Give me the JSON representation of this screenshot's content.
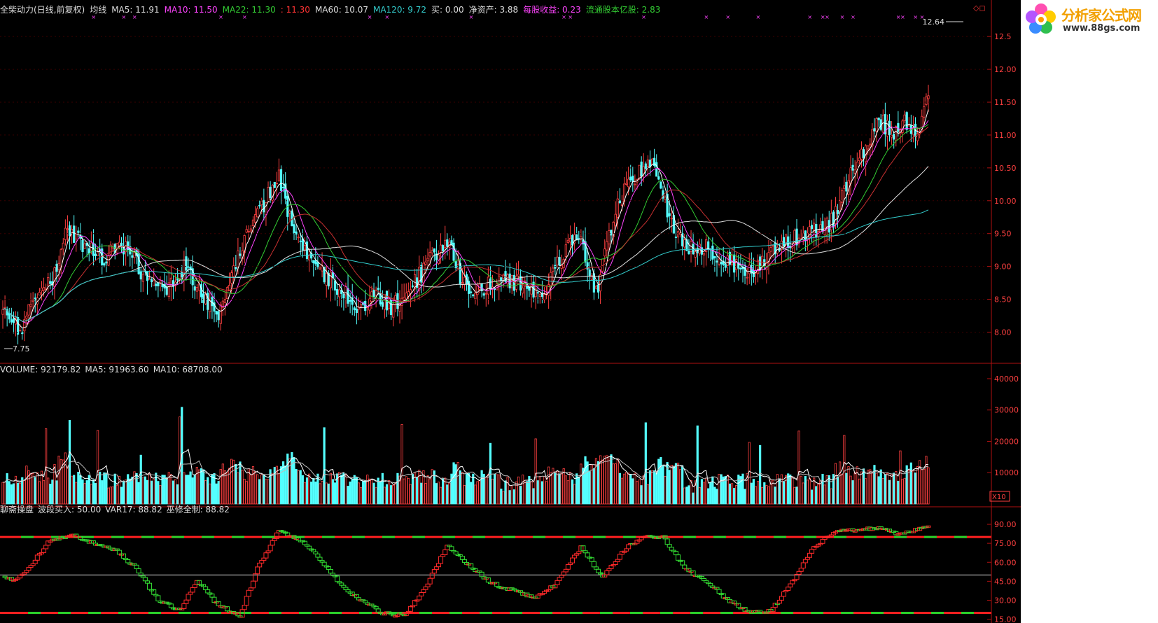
{
  "header": {
    "stock_name": "全柴动力(日线,前复权)",
    "indicator_name": "均线",
    "ma5": "MA5: 11.91",
    "ma10": "MA10: 11.50",
    "ma22": "MA22: 11.30",
    "ma22b": ": 11.30",
    "ma60": "MA60: 10.07",
    "ma120": "MA120: 9.72",
    "buy": "买: 0.00",
    "net_assets": "净资产: 3.88",
    "eps": "每股收益: 0.23",
    "float_shares": "流通股本亿股: 2.83",
    "colors": {
      "ma5": "#ffffff",
      "ma10": "#ff44ff",
      "ma22": "#33cc33",
      "ma60": "#e0e0e0",
      "ma120": "#33cccc",
      "eps": "#ff44ff",
      "float": "#33cc33",
      "red": "#ff3333"
    }
  },
  "price_pane": {
    "high_label": "12.64",
    "low_label": "7.75",
    "y_ticks": [
      "12.5",
      "12.00",
      "11.50",
      "11.00",
      "10.50",
      "10.00",
      "9.50",
      "9.00",
      "8.50",
      "8.00"
    ],
    "y_min": 7.6,
    "y_max": 12.8
  },
  "volume_pane": {
    "title": "VOLUME: 92179.82",
    "ma5": "MA5: 91963.60",
    "ma10": "MA10: 68708.00",
    "y_ticks": [
      "40000",
      "30000",
      "20000",
      "10000"
    ],
    "unit": "X10",
    "y_max": 42000
  },
  "indicator_pane": {
    "name": "聊斋操盘",
    "buy": "波段买入: 50.00",
    "var17": "VAR17: 88.82",
    "control": "巫修全制: 88.82",
    "y_ticks": [
      "90.00",
      "75.00",
      "60.00",
      "45.00",
      "30.00",
      "15.00"
    ],
    "y_min": 12,
    "y_max": 95,
    "levels": [
      80,
      50,
      20
    ]
  },
  "logo": {
    "title": "分析家公式网",
    "url": "www.88gs.com"
  },
  "chart_data": {
    "type": "line",
    "title": "全柴动力(日线,前复权)",
    "anchor_closes": [
      [
        0,
        8.3
      ],
      [
        8,
        8.05
      ],
      [
        15,
        8.5
      ],
      [
        25,
        8.9
      ],
      [
        30,
        9.6
      ],
      [
        35,
        9.4
      ],
      [
        45,
        9.1
      ],
      [
        55,
        9.35
      ],
      [
        65,
        8.9
      ],
      [
        75,
        8.65
      ],
      [
        85,
        9.0
      ],
      [
        95,
        8.4
      ],
      [
        100,
        8.25
      ],
      [
        110,
        9.3
      ],
      [
        120,
        9.9
      ],
      [
        128,
        10.4
      ],
      [
        135,
        9.5
      ],
      [
        145,
        9.0
      ],
      [
        155,
        8.7
      ],
      [
        165,
        8.4
      ],
      [
        175,
        8.55
      ],
      [
        180,
        8.4
      ],
      [
        190,
        8.7
      ],
      [
        200,
        9.2
      ],
      [
        207,
        9.35
      ],
      [
        212,
        8.85
      ],
      [
        220,
        8.6
      ],
      [
        230,
        8.8
      ],
      [
        240,
        8.75
      ],
      [
        250,
        8.6
      ],
      [
        260,
        9.2
      ],
      [
        267,
        9.5
      ],
      [
        275,
        8.6
      ],
      [
        285,
        10.0
      ],
      [
        295,
        10.4
      ],
      [
        300,
        10.6
      ],
      [
        305,
        10.1
      ],
      [
        315,
        9.3
      ],
      [
        325,
        9.3
      ],
      [
        335,
        9.1
      ],
      [
        345,
        8.9
      ],
      [
        355,
        9.15
      ],
      [
        365,
        9.4
      ],
      [
        375,
        9.5
      ],
      [
        385,
        9.7
      ],
      [
        392,
        10.3
      ],
      [
        400,
        10.8
      ],
      [
        405,
        11.3
      ],
      [
        412,
        11.0
      ],
      [
        418,
        11.3
      ],
      [
        423,
        10.9
      ],
      [
        429,
        11.6
      ]
    ],
    "indicator_anchors": [
      [
        0,
        50
      ],
      [
        5,
        45
      ],
      [
        12,
        55
      ],
      [
        22,
        78
      ],
      [
        32,
        82
      ],
      [
        42,
        75
      ],
      [
        52,
        70
      ],
      [
        62,
        55
      ],
      [
        72,
        30
      ],
      [
        82,
        22
      ],
      [
        90,
        45
      ],
      [
        100,
        26
      ],
      [
        110,
        18
      ],
      [
        118,
        55
      ],
      [
        128,
        85
      ],
      [
        138,
        78
      ],
      [
        148,
        60
      ],
      [
        158,
        40
      ],
      [
        168,
        28
      ],
      [
        176,
        20
      ],
      [
        186,
        18
      ],
      [
        196,
        40
      ],
      [
        206,
        73
      ],
      [
        216,
        58
      ],
      [
        226,
        44
      ],
      [
        236,
        38
      ],
      [
        246,
        32
      ],
      [
        256,
        42
      ],
      [
        268,
        72
      ],
      [
        278,
        48
      ],
      [
        288,
        70
      ],
      [
        296,
        80
      ],
      [
        306,
        80
      ],
      [
        316,
        55
      ],
      [
        328,
        42
      ],
      [
        336,
        30
      ],
      [
        346,
        20
      ],
      [
        356,
        22
      ],
      [
        366,
        45
      ],
      [
        376,
        72
      ],
      [
        386,
        84
      ],
      [
        396,
        86
      ],
      [
        406,
        87
      ],
      [
        416,
        82
      ],
      [
        424,
        86
      ],
      [
        429,
        88
      ]
    ]
  }
}
